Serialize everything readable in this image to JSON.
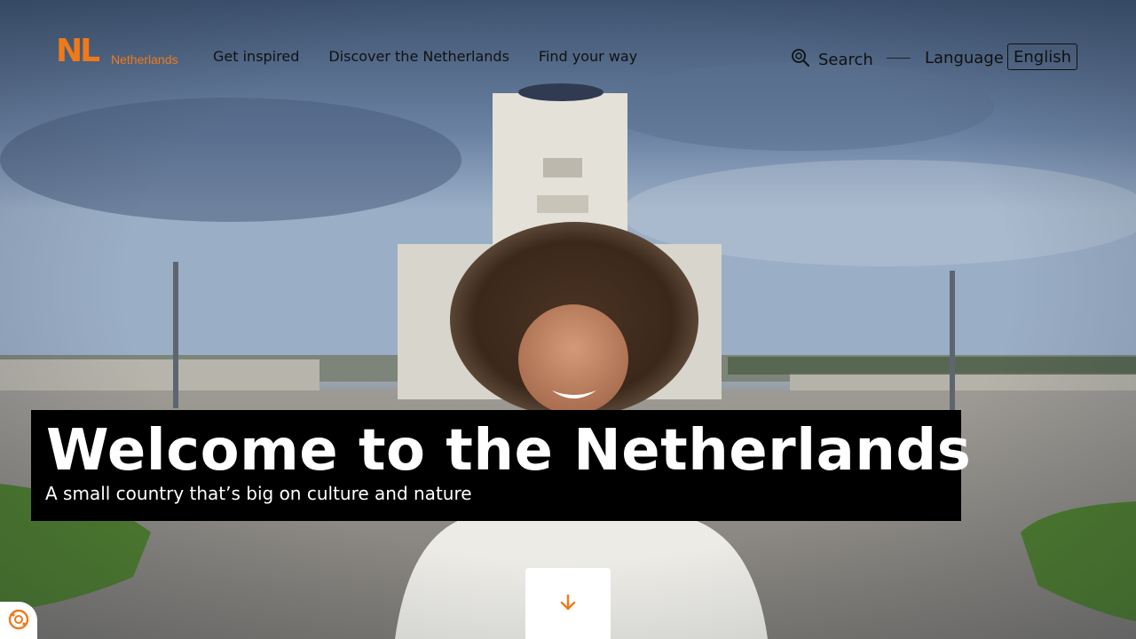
{
  "brand": {
    "mark": "NL",
    "wordmark": "Netherlands",
    "color": "#ef7a1a"
  },
  "nav": {
    "items": [
      {
        "label": "Get inspired"
      },
      {
        "label": "Discover the Netherlands"
      },
      {
        "label": "Find your way"
      }
    ]
  },
  "header_tools": {
    "search_label": "Search",
    "search_icon": "search-icon",
    "language_label": "Language",
    "language_value": "English"
  },
  "hero": {
    "title": "Welcome to the Netherlands",
    "subtitle": "A small country that’s big on culture and nature",
    "scroll_icon": "arrow-down-icon"
  },
  "cookie": {
    "icon": "cookie-settings-icon"
  }
}
